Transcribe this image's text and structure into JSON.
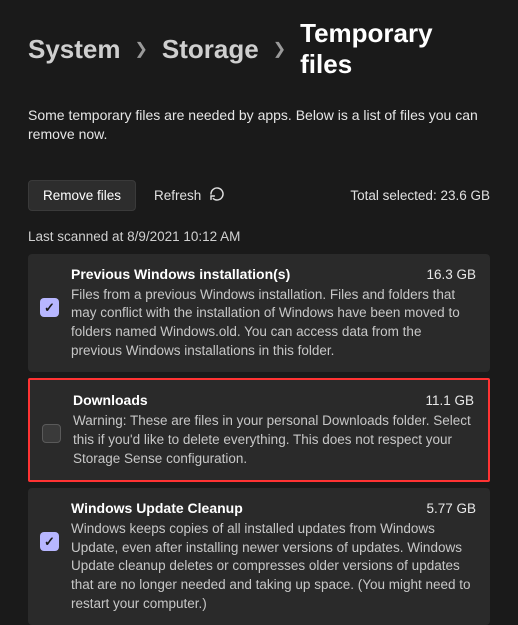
{
  "breadcrumb": {
    "system": "System",
    "storage": "Storage",
    "current": "Temporary files"
  },
  "intro": "Some temporary files are needed by apps. Below is a list of files you can remove now.",
  "toolbar": {
    "remove_label": "Remove files",
    "refresh_label": "Refresh",
    "total_label": "Total selected:",
    "total_value": "23.6 GB"
  },
  "last_scanned": "Last scanned at 8/9/2021 10:12 AM",
  "items": [
    {
      "title": "Previous Windows installation(s)",
      "size": "16.3 GB",
      "desc": "Files from a previous Windows installation.  Files and folders that may conflict with the installation of Windows have been moved to folders named Windows.old.  You can access data from the previous Windows installations in this folder.",
      "checked": true,
      "highlight": false
    },
    {
      "title": "Downloads",
      "size": "11.1 GB",
      "desc": "Warning: These are files in your personal Downloads folder. Select this if you'd like to delete everything. This does not respect your Storage Sense configuration.",
      "checked": false,
      "highlight": true
    },
    {
      "title": "Windows Update Cleanup",
      "size": "5.77 GB",
      "desc": "Windows keeps copies of all installed updates from Windows Update, even after installing newer versions of updates. Windows Update cleanup deletes or compresses older versions of updates that are no longer needed and taking up space. (You might need to restart your computer.)",
      "checked": true,
      "highlight": false
    }
  ]
}
